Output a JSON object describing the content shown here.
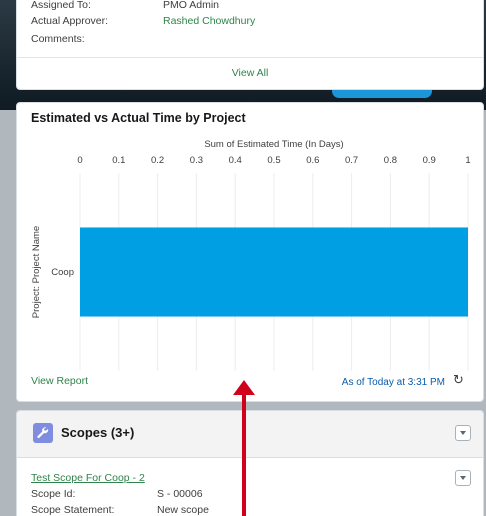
{
  "approval": {
    "assigned_to_label": "Assigned To:",
    "assigned_to_value": "PMO Admin",
    "actual_approver_label": "Actual Approver:",
    "actual_approver_value": "Rashed Chowdhury",
    "comments_label": "Comments:",
    "view_all": "View All"
  },
  "chart_card": {
    "title": "Estimated vs Actual Time by Project",
    "view_report": "View Report",
    "as_of": "As of Today at 3:31 PM",
    "refresh_icon": "refresh-icon"
  },
  "chart_data": {
    "type": "bar",
    "orientation": "horizontal",
    "title": "",
    "xlabel": "Sum of Estimated Time (In Days)",
    "ylabel": "Project: Project Name",
    "categories": [
      "Coop"
    ],
    "values": [
      1
    ],
    "xlim": [
      0,
      1
    ],
    "xticks": [
      "0",
      "0.1",
      "0.2",
      "0.3",
      "0.4",
      "0.5",
      "0.6",
      "0.7",
      "0.8",
      "0.9",
      "1"
    ],
    "grid": true,
    "bar_color": "#009fe3"
  },
  "scopes": {
    "title": "Scopes (3+)",
    "item_link": "Test Scope For Coop - 2",
    "scope_id_label": "Scope Id:",
    "scope_id_value": "S - 00006",
    "scope_statement_label": "Scope Statement:",
    "scope_statement_value": "New scope"
  },
  "colors": {
    "link_green": "#2e844a",
    "bar_blue": "#009fe3",
    "annotation_red": "#d0021b"
  }
}
